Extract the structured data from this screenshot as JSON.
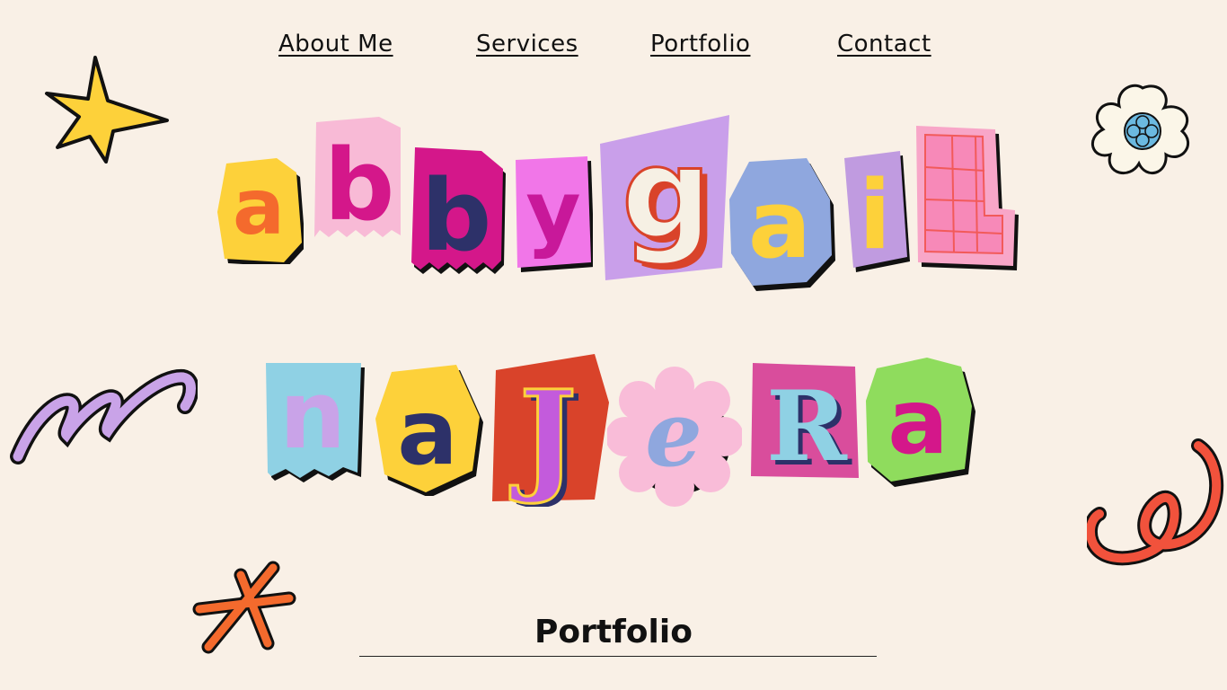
{
  "nav": {
    "items": [
      {
        "label": "About Me"
      },
      {
        "label": "Services"
      },
      {
        "label": "Portfolio"
      },
      {
        "label": "Contact"
      }
    ]
  },
  "hero": {
    "first_name": [
      "a",
      "b",
      "b",
      "y",
      "g",
      "a",
      "i",
      "L"
    ],
    "last_name": [
      "n",
      "a",
      "J",
      "e",
      "R",
      "a"
    ]
  },
  "section": {
    "title": "Portfolio"
  },
  "colors": {
    "background": "#f9f0e6",
    "yellow": "#fdd13a",
    "orange": "#f46a2d",
    "pink": "#f7b8d6",
    "magenta": "#d4178a",
    "navy": "#2d3169",
    "violet": "#c79de9",
    "blue": "#8fa7de",
    "sky": "#8fd1e4",
    "red": "#d9432a",
    "green": "#8fdc5d"
  },
  "icons": [
    "star-icon",
    "flower-icon",
    "squiggle-icon",
    "swirl-icon",
    "asterisk-icon"
  ]
}
